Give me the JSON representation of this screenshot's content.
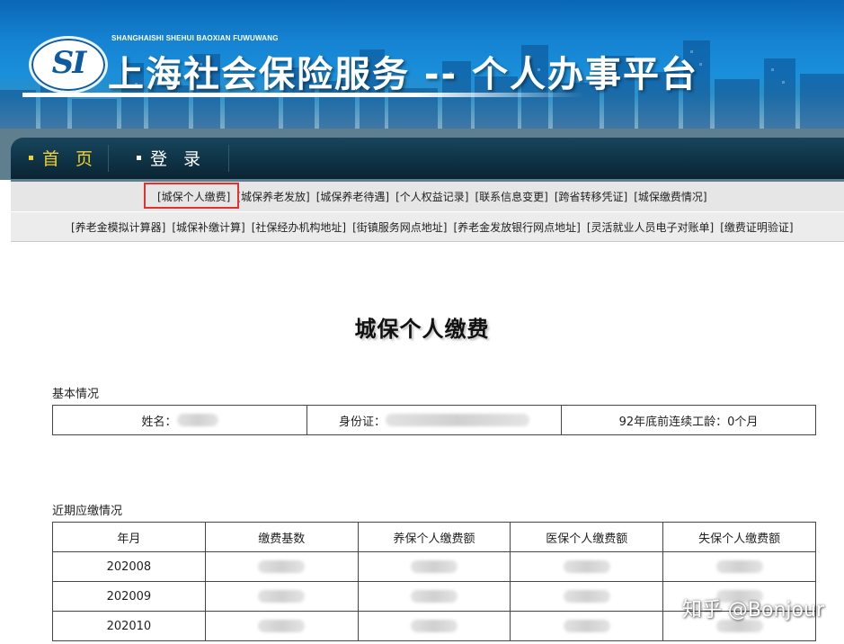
{
  "header": {
    "logo_text": "SI",
    "pinyin": "SHANGHAISHI SHEHUI BAOXIAN FUWUWANG",
    "title": "上海社会保险服务 -- 个人办事平台"
  },
  "nav": {
    "home": "首 页",
    "login": "登 录"
  },
  "links_row1": [
    "[城保个人缴费]",
    "[城保养老发放]",
    "[城保养老待遇]",
    "[个人权益记录]",
    "[联系信息变更]",
    "[跨省转移凭证]",
    "[城保缴费情况]"
  ],
  "links_row2": [
    "[养老金模拟计算器]",
    "[城保补缴计算]",
    "[社保经办机构地址]",
    "[街镇服务网点地址]",
    "[养老金发放银行网点地址]",
    "[灵活就业人员电子对账单]",
    "[缴费证明验证]"
  ],
  "page_title": "城保个人缴费",
  "basic_info": {
    "label": "基本情况",
    "name_label": "姓名：",
    "id_label": "身份证：",
    "years_text": "92年底前连续工龄：0个月"
  },
  "payments": {
    "label": "近期应缴情况",
    "headers": [
      "年月",
      "缴费基数",
      "养保个人缴费额",
      "医保个人缴费额",
      "失保个人缴费额"
    ],
    "rows": [
      {
        "month": "202008"
      },
      {
        "month": "202009"
      },
      {
        "month": "202010"
      }
    ]
  },
  "watermark": "知乎 @Bonjour",
  "colors": {
    "highlight": "#e0312f",
    "nav_active": "#f3d12d",
    "banner": "#1583d2"
  }
}
